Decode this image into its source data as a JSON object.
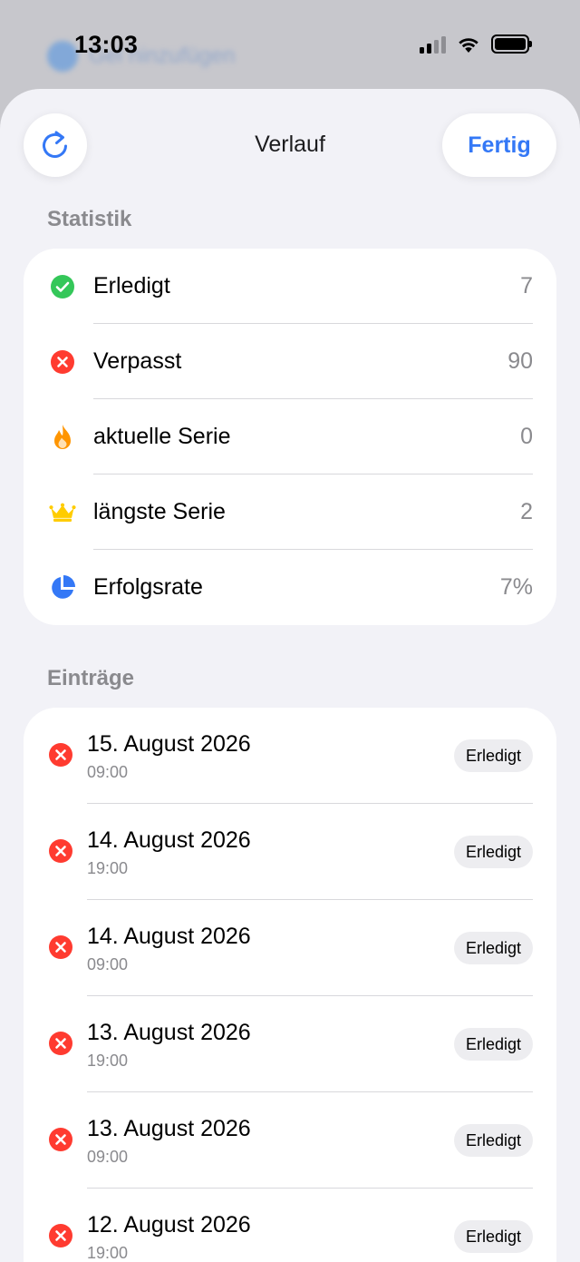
{
  "status_bar": {
    "time": "13:03",
    "background_text": "Gel hinzufügen"
  },
  "nav": {
    "title": "Verlauf",
    "done_label": "Fertig",
    "left_icon": "arrow-clockwise-icon"
  },
  "statistics": {
    "header": "Statistik",
    "rows": [
      {
        "label": "Erledigt",
        "value": "7",
        "icon": "checkmark-circle-icon",
        "color": "#34c759"
      },
      {
        "label": "Verpasst",
        "value": "90",
        "icon": "xmark-circle-icon",
        "color": "#ff3b30"
      },
      {
        "label": "aktuelle Serie",
        "value": "0",
        "icon": "flame-icon",
        "color": "#ff9500"
      },
      {
        "label": "längste Serie",
        "value": "2",
        "icon": "crown-icon",
        "color": "#ffcc00"
      },
      {
        "label": "Erfolgsrate",
        "value": "7%",
        "icon": "pie-chart-icon",
        "color": "#3478f6"
      }
    ]
  },
  "entries": {
    "header": "Einträge",
    "items": [
      {
        "date": "15. August 2026",
        "time": "09:00",
        "action": "Erledigt",
        "icon": "xmark-circle-icon"
      },
      {
        "date": "14. August 2026",
        "time": "19:00",
        "action": "Erledigt",
        "icon": "xmark-circle-icon"
      },
      {
        "date": "14. August 2026",
        "time": "09:00",
        "action": "Erledigt",
        "icon": "xmark-circle-icon"
      },
      {
        "date": "13. August 2026",
        "time": "19:00",
        "action": "Erledigt",
        "icon": "xmark-circle-icon"
      },
      {
        "date": "13. August 2026",
        "time": "09:00",
        "action": "Erledigt",
        "icon": "xmark-circle-icon"
      },
      {
        "date": "12. August 2026",
        "time": "19:00",
        "action": "Erledigt",
        "icon": "xmark-circle-icon"
      }
    ]
  },
  "colors": {
    "accent": "#3478f6",
    "success": "#34c759",
    "missed": "#ff3b30",
    "background": "#f2f2f7"
  }
}
